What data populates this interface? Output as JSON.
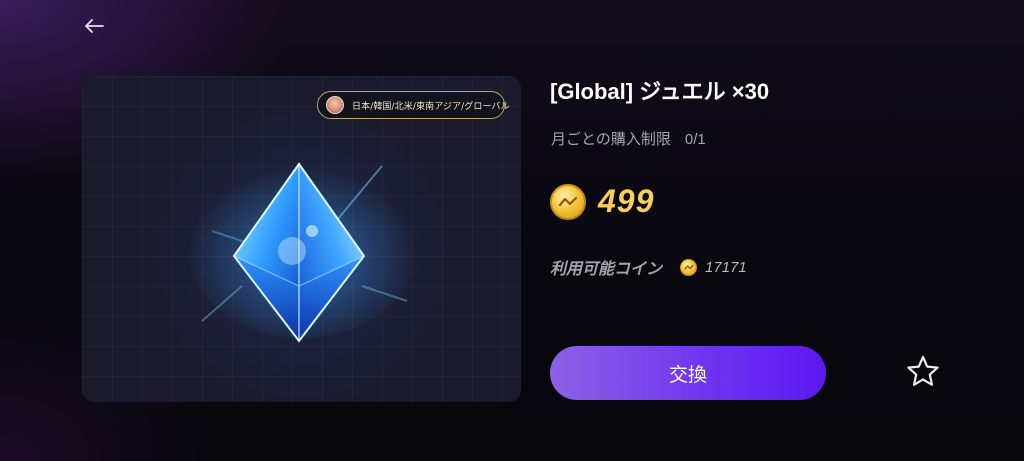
{
  "header": {
    "back_icon": "back-arrow-icon"
  },
  "item_card": {
    "region_badge": "日本/韓国/北米/東南アジア/グローバル",
    "image_icon": "jewel-crystal-icon"
  },
  "product": {
    "title": "[Global] ジュエル ×30",
    "limit_label": "月ごとの購入制限",
    "limit_value": "0/1",
    "price": "499",
    "coin_icon": "gold-coin-icon",
    "available_label": "利用可能コイン",
    "available_value": "17171"
  },
  "actions": {
    "exchange_label": "交換",
    "favorite_icon": "star-outline-icon"
  },
  "colors": {
    "accent_purple": "#6f35f0",
    "price_gold": "#f8cf58",
    "badge_border": "#b9a56e"
  }
}
